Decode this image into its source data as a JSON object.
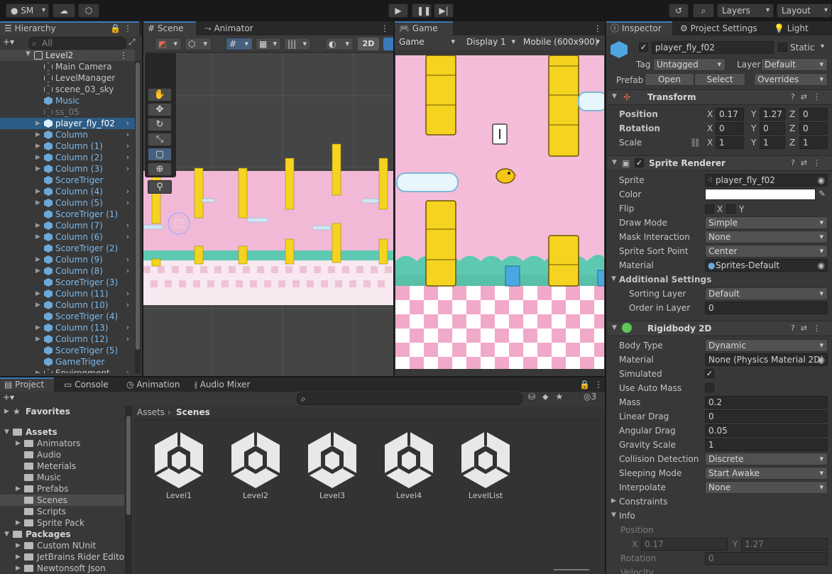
{
  "toolbar": {
    "account": "SM",
    "layers": "Layers",
    "layout": "Layout"
  },
  "hierarchy": {
    "tab": "Hierarchy",
    "search_placeholder": "All",
    "scene": "Level2",
    "items": [
      {
        "label": "Main Camera",
        "style": "normal",
        "indent": 1,
        "children": false
      },
      {
        "label": "LevelManager",
        "style": "normal",
        "indent": 1,
        "children": false
      },
      {
        "label": "scene_03_sky",
        "style": "normal",
        "indent": 1,
        "children": false
      },
      {
        "label": "Music",
        "style": "blue",
        "indent": 1,
        "children": false
      },
      {
        "label": "ss_05",
        "style": "dim",
        "indent": 1,
        "children": false
      },
      {
        "label": "player_fly_f02",
        "style": "selected",
        "indent": 1,
        "children": true
      },
      {
        "label": "Column",
        "style": "blue",
        "indent": 1,
        "children": true
      },
      {
        "label": "Column (1)",
        "style": "blue",
        "indent": 1,
        "children": true
      },
      {
        "label": "Column (2)",
        "style": "blue",
        "indent": 1,
        "children": true
      },
      {
        "label": "Column (3)",
        "style": "blue",
        "indent": 1,
        "children": true
      },
      {
        "label": "ScoreTriger",
        "style": "blue",
        "indent": 1,
        "children": false
      },
      {
        "label": "Column (4)",
        "style": "blue",
        "indent": 1,
        "children": true
      },
      {
        "label": "Column (5)",
        "style": "blue",
        "indent": 1,
        "children": true
      },
      {
        "label": "ScoreTriger (1)",
        "style": "blue",
        "indent": 1,
        "children": false
      },
      {
        "label": "Column (7)",
        "style": "blue",
        "indent": 1,
        "children": true
      },
      {
        "label": "Column (6)",
        "style": "blue",
        "indent": 1,
        "children": true
      },
      {
        "label": "ScoreTriger (2)",
        "style": "blue",
        "indent": 1,
        "children": false
      },
      {
        "label": "Column (9)",
        "style": "blue",
        "indent": 1,
        "children": true
      },
      {
        "label": "Column (8)",
        "style": "blue",
        "indent": 1,
        "children": true
      },
      {
        "label": "ScoreTriger (3)",
        "style": "blue",
        "indent": 1,
        "children": false
      },
      {
        "label": "Column (11)",
        "style": "blue",
        "indent": 1,
        "children": true
      },
      {
        "label": "Column (10)",
        "style": "blue",
        "indent": 1,
        "children": true
      },
      {
        "label": "ScoreTriger (4)",
        "style": "blue",
        "indent": 1,
        "children": false
      },
      {
        "label": "Column (13)",
        "style": "blue",
        "indent": 1,
        "children": true
      },
      {
        "label": "Column (12)",
        "style": "blue",
        "indent": 1,
        "children": true
      },
      {
        "label": "ScoreTriger (5)",
        "style": "blue",
        "indent": 1,
        "children": false
      },
      {
        "label": "GameTriger",
        "style": "blue",
        "indent": 1,
        "children": false
      },
      {
        "label": "Environment",
        "style": "normal",
        "indent": 1,
        "children": true
      }
    ]
  },
  "scene": {
    "tab_scene": "Scene",
    "tab_animator": "Animator",
    "btn_2d": "2D"
  },
  "game": {
    "tab": "Game",
    "mode": "Game",
    "display": "Display 1",
    "resolution": "Mobile (600x900)"
  },
  "inspector": {
    "tab_inspector": "Inspector",
    "tab_project_settings": "Project Settings",
    "tab_light": "Light",
    "object_name": "player_fly_f02",
    "static_label": "Static",
    "tag_label": "Tag",
    "tag_value": "Untagged",
    "layer_label": "Layer",
    "layer_value": "Default",
    "prefab_label": "Prefab",
    "open": "Open",
    "select": "Select",
    "overrides": "Overrides",
    "transform": {
      "title": "Transform",
      "position_label": "Position",
      "rotation_label": "Rotation",
      "scale_label": "Scale",
      "position": [
        "0.17",
        "1.27",
        "0"
      ],
      "rotation": [
        "0",
        "0",
        "0"
      ],
      "scale": [
        "1",
        "1",
        "1"
      ]
    },
    "axis": {
      "x": "X",
      "y": "Y",
      "z": "Z"
    },
    "sprite_renderer": {
      "title": "Sprite Renderer",
      "sprite_label": "Sprite",
      "sprite_value": "player_fly_f02",
      "color_label": "Color",
      "flip_label": "Flip",
      "draw_mode_label": "Draw Mode",
      "draw_mode": "Simple",
      "mask_label": "Mask Interaction",
      "mask": "None",
      "sort_point_label": "Sprite Sort Point",
      "sort_point": "Center",
      "material_label": "Material",
      "material": "Sprites-Default",
      "additional": "Additional Settings",
      "sorting_layer_label": "Sorting Layer",
      "sorting_layer": "Default",
      "order_label": "Order in Layer",
      "order": "0"
    },
    "rigidbody": {
      "title": "Rigidbody 2D",
      "body_type_label": "Body Type",
      "body_type": "Dynamic",
      "material_label": "Material",
      "material": "None (Physics Material 2D)",
      "simulated_label": "Simulated",
      "auto_mass_label": "Use Auto Mass",
      "mass_label": "Mass",
      "mass": "0.2",
      "linear_drag_label": "Linear Drag",
      "linear_drag": "0",
      "angular_drag_label": "Angular Drag",
      "angular_drag": "0.05",
      "gravity_label": "Gravity Scale",
      "gravity": "1",
      "collision_label": "Collision Detection",
      "collision": "Discrete",
      "sleeping_label": "Sleeping Mode",
      "sleeping": "Start Awake",
      "interpolate_label": "Interpolate",
      "interpolate": "None",
      "constraints_label": "Constraints",
      "info_label": "Info",
      "info_position_label": "Position",
      "info_x": "0.17",
      "info_y": "1.27",
      "info_rotation_label": "Rotation",
      "info_rotation": "0",
      "velocity_label": "Velocity"
    }
  },
  "project": {
    "tab_project": "Project",
    "tab_console": "Console",
    "tab_animation": "Animation",
    "tab_audio_mixer": "Audio Mixer",
    "badge": "3",
    "breadcrumb_root": "Assets",
    "breadcrumb_current": "Scenes",
    "tree": [
      {
        "label": "Favorites",
        "level": 0,
        "expanded": false,
        "star": true
      },
      {
        "label": "Assets",
        "level": 0,
        "expanded": true,
        "bold": true
      },
      {
        "label": "Animators",
        "level": 1,
        "expanded": false,
        "arrow": true
      },
      {
        "label": "Audio",
        "level": 1
      },
      {
        "label": "Meterials",
        "level": 1
      },
      {
        "label": "Music",
        "level": 1
      },
      {
        "label": "Prefabs",
        "level": 1,
        "arrow": true
      },
      {
        "label": "Scenes",
        "level": 1,
        "selected": true
      },
      {
        "label": "Scripts",
        "level": 1
      },
      {
        "label": "Sprite Pack",
        "level": 1,
        "arrow": true
      },
      {
        "label": "Packages",
        "level": 0,
        "expanded": true,
        "bold": true
      },
      {
        "label": "Custom NUnit",
        "level": 1,
        "arrow": true
      },
      {
        "label": "JetBrains Rider Editor",
        "level": 1,
        "arrow": true
      },
      {
        "label": "Newtonsoft Json",
        "level": 1,
        "arrow": true
      }
    ],
    "assets": [
      "Level1",
      "Level2",
      "Level3",
      "Level4",
      "LevelList"
    ]
  }
}
